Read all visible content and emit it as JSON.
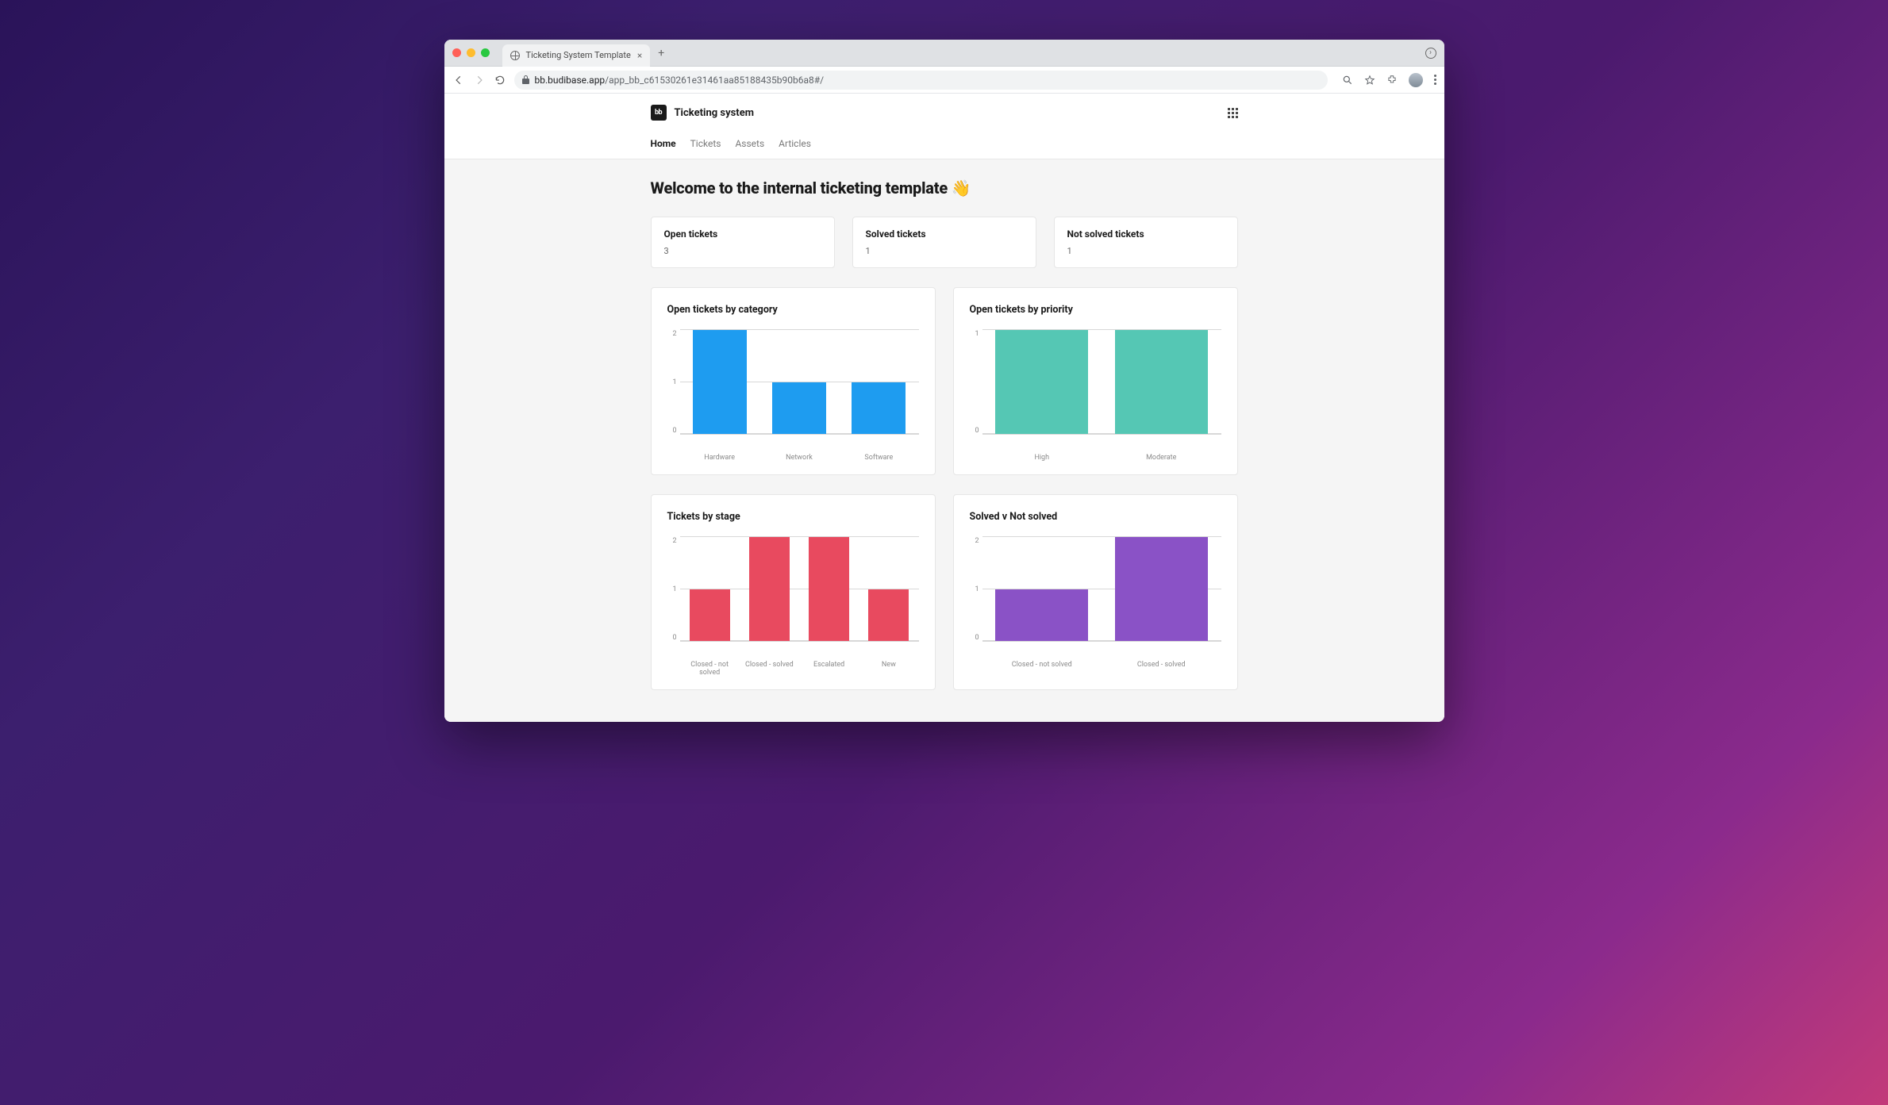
{
  "browser": {
    "tab_title": "Ticketing System Template",
    "url_host": "bb.budibase.app",
    "url_path": "/app_bb_c61530261e31461aa85188435b90b6a8#/"
  },
  "app": {
    "brand_logo_text": "bb",
    "brand_name": "Ticketing system",
    "nav": {
      "home": "Home",
      "tickets": "Tickets",
      "assets": "Assets",
      "articles": "Articles"
    },
    "page_title": "Welcome to the internal ticketing template 👋"
  },
  "stats": {
    "open": {
      "label": "Open tickets",
      "value": "3"
    },
    "solved": {
      "label": "Solved tickets",
      "value": "1"
    },
    "not_solved": {
      "label": "Not solved tickets",
      "value": "1"
    }
  },
  "chart_data": [
    {
      "id": "open_by_category",
      "type": "bar",
      "title": "Open tickets by category",
      "categories": [
        "Hardware",
        "Network",
        "Software"
      ],
      "values": [
        2,
        1,
        1
      ],
      "ylim": [
        0,
        2
      ],
      "yticks": [
        0,
        1,
        2
      ],
      "color": "#1e9cf0"
    },
    {
      "id": "open_by_priority",
      "type": "bar",
      "title": "Open tickets by priority",
      "categories": [
        "High",
        "Moderate"
      ],
      "values": [
        1,
        1
      ],
      "ylim": [
        0,
        1
      ],
      "yticks": [
        0,
        1
      ],
      "color": "#55c7b4",
      "bar_wide": true
    },
    {
      "id": "tickets_by_stage",
      "type": "bar",
      "title": "Tickets by stage",
      "categories": [
        "Closed - not solved",
        "Closed - solved",
        "Escalated",
        "New"
      ],
      "values": [
        1,
        2,
        2,
        1
      ],
      "ylim": [
        0,
        2
      ],
      "yticks": [
        0,
        1,
        2
      ],
      "color": "#e84a5f"
    },
    {
      "id": "solved_v_not",
      "type": "bar",
      "title": "Solved v Not solved",
      "categories": [
        "Closed - not solved",
        "Closed - solved"
      ],
      "values": [
        1,
        2
      ],
      "ylim": [
        0,
        2
      ],
      "yticks": [
        0,
        1,
        2
      ],
      "color": "#8a52c6",
      "bar_wide": true
    }
  ]
}
